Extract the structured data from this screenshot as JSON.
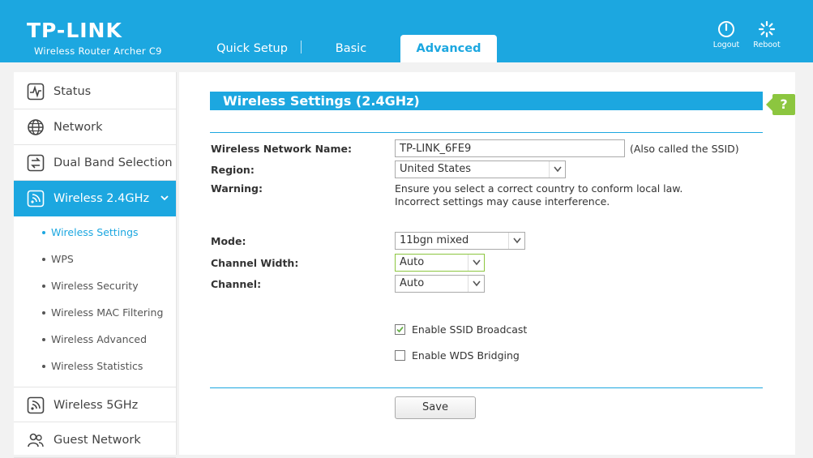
{
  "header": {
    "brand": "TP-LINK",
    "model": "Wireless Router Archer C9",
    "tabs": [
      {
        "label": "Quick Setup"
      },
      {
        "label": "Basic"
      },
      {
        "label": "Advanced",
        "active": true
      }
    ],
    "logout_label": "Logout",
    "reboot_label": "Reboot"
  },
  "sidebar": {
    "items": [
      {
        "label": "Status",
        "icon": "status-icon"
      },
      {
        "label": "Network",
        "icon": "globe-icon"
      },
      {
        "label": "Dual Band Selection",
        "icon": "dual-band-icon"
      },
      {
        "label": "Wireless 2.4GHz",
        "icon": "wireless-icon",
        "active": true
      },
      {
        "label": "Wireless 5GHz",
        "icon": "wireless-icon"
      },
      {
        "label": "Guest Network",
        "icon": "guest-icon"
      }
    ],
    "subitems": [
      {
        "label": "Wireless Settings",
        "active": true
      },
      {
        "label": "WPS"
      },
      {
        "label": "Wireless Security"
      },
      {
        "label": "Wireless MAC Filtering"
      },
      {
        "label": "Wireless Advanced"
      },
      {
        "label": "Wireless Statistics"
      }
    ]
  },
  "main": {
    "title": "Wireless Settings (2.4GHz)",
    "help_label": "?",
    "fields": {
      "ssid_label": "Wireless Network Name:",
      "ssid_value": "TP-LINK_6FE9",
      "ssid_note": "(Also called the SSID)",
      "region_label": "Region:",
      "region_value": "United States",
      "warning_label": "Warning:",
      "warning_line1": "Ensure you select a correct country to conform local law.",
      "warning_line2": "Incorrect settings may cause interference.",
      "mode_label": "Mode:",
      "mode_value": "11bgn mixed",
      "channel_width_label": "Channel Width:",
      "channel_width_value": "Auto",
      "channel_label": "Channel:",
      "channel_value": "Auto"
    },
    "checkboxes": {
      "ssid_broadcast_label": "Enable SSID Broadcast",
      "ssid_broadcast_checked": true,
      "wds_label": "Enable WDS Bridging",
      "wds_checked": false
    },
    "save_label": "Save"
  },
  "colors": {
    "brand_blue": "#1ca7e0",
    "accent_green": "#8cc63f"
  }
}
